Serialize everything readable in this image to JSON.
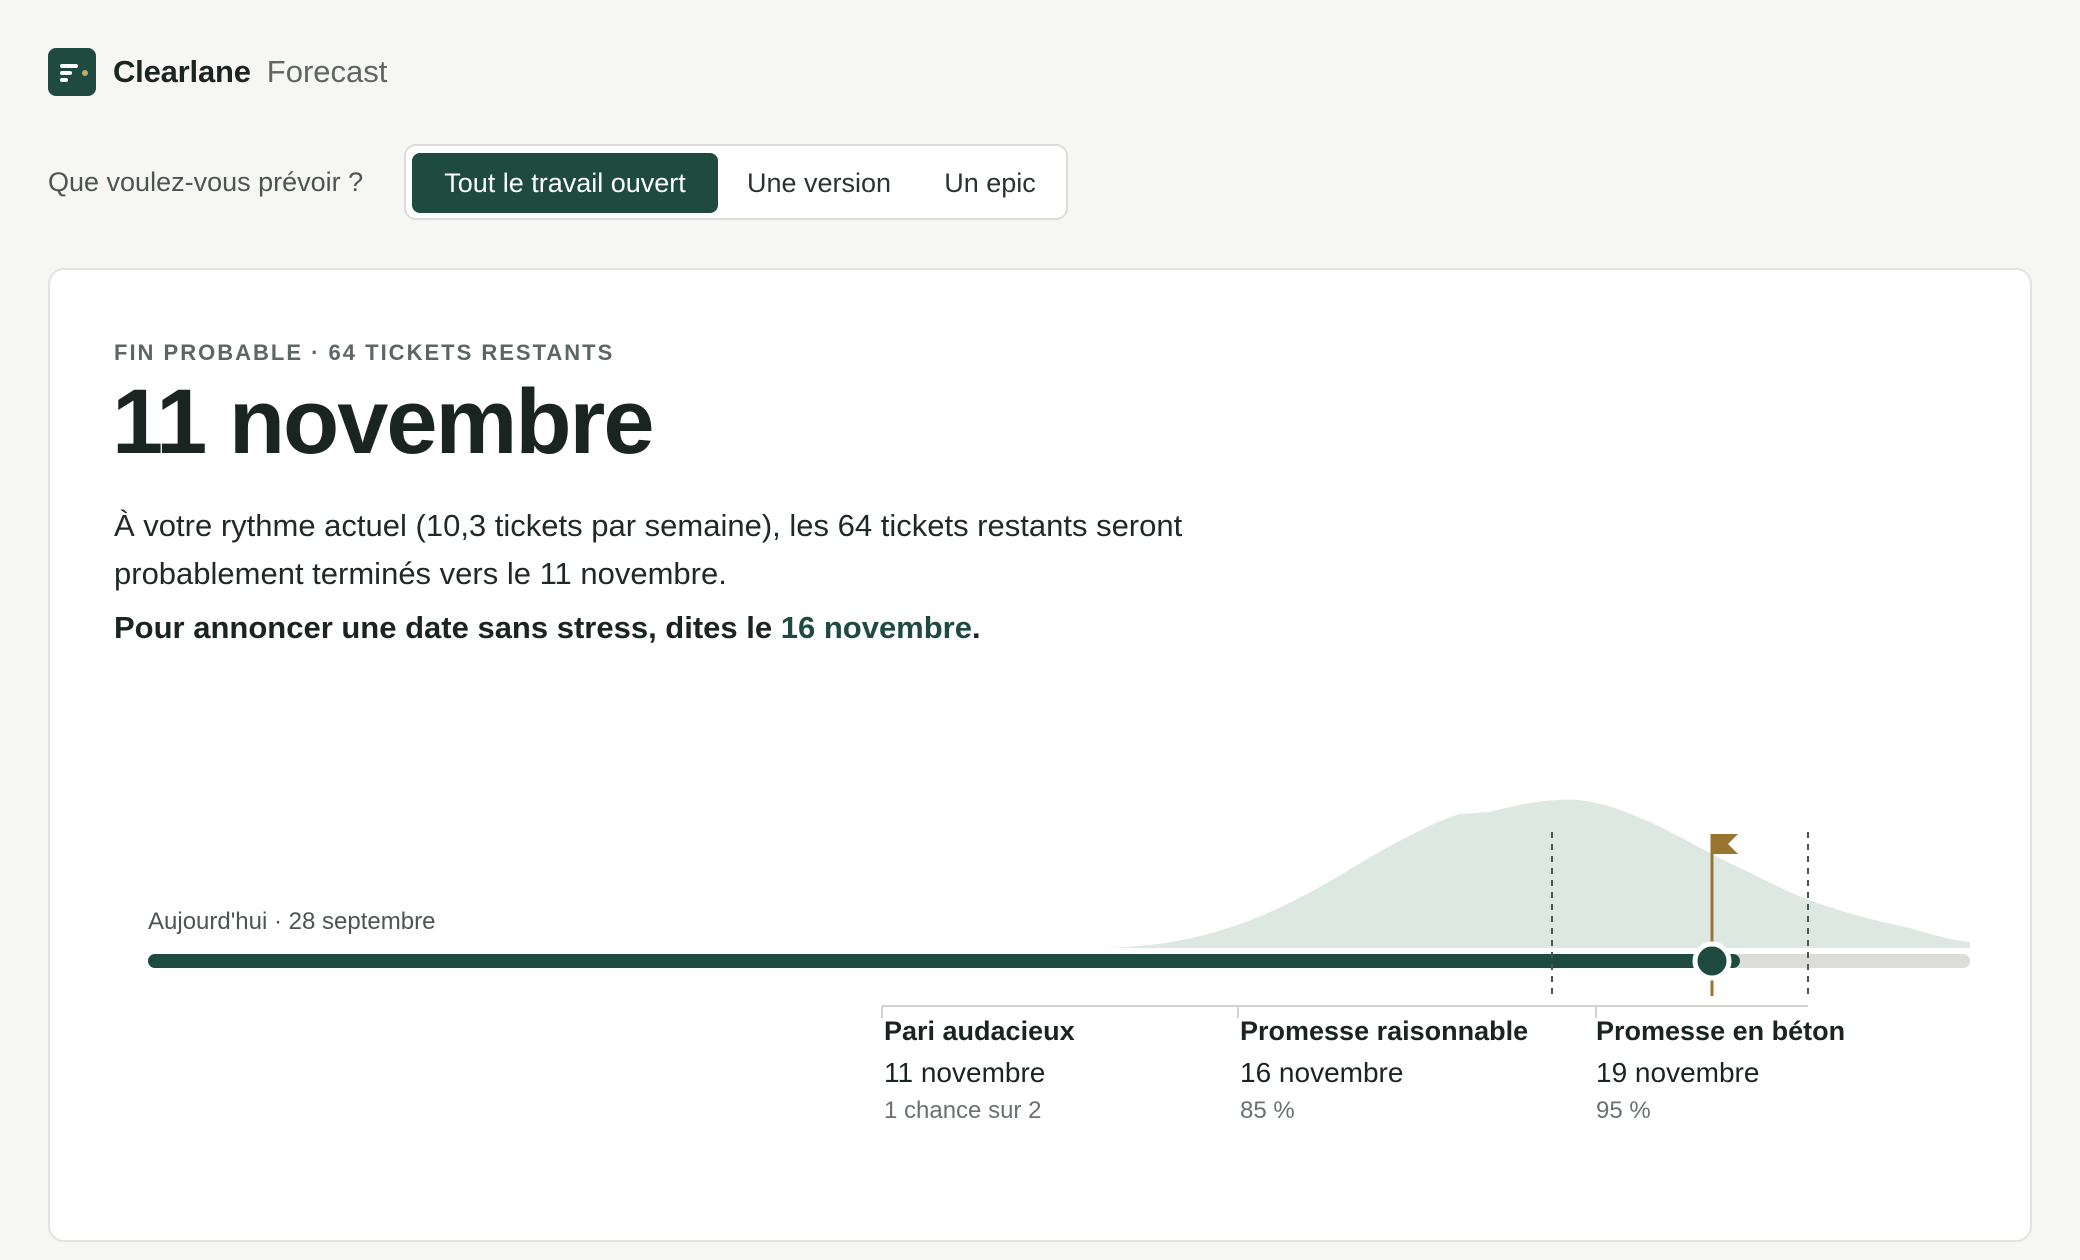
{
  "brand": {
    "name": "Clearlane",
    "product": "Forecast",
    "logo_icon": "forecast-logo-icon"
  },
  "scope": {
    "question": "Que voulez-vous prévoir ?",
    "options": [
      {
        "label": "Tout le travail ouvert",
        "selected": true
      },
      {
        "label": "Une version",
        "selected": false
      },
      {
        "label": "Un epic",
        "selected": false
      }
    ]
  },
  "forecast": {
    "eyebrow": "FIN PROBABLE · 64 TICKETS RESTANTS",
    "headline_date": "11 novembre",
    "summary": "À votre rythme actuel (10,3 tickets par semaine), les 64 tickets restants seront probablement terminés vers le 11 novembre.",
    "advice_prefix": "Pour annoncer une date sans stress, dites le ",
    "advice_date": "16 novembre",
    "advice_suffix": "."
  },
  "timeline": {
    "today_label": "Aujourd'hui · 28 septembre",
    "progress_fraction": 0.874,
    "colors": {
      "accent": "#1f4a40",
      "distribution": "#dde8e3",
      "flag": "#9a7530",
      "track": "#dcdcd8"
    },
    "tiers": [
      {
        "title": "Pari audacieux",
        "date": "11 novembre",
        "probability": "1 chance sur 2"
      },
      {
        "title": "Promesse raisonnable",
        "date": "16 novembre",
        "probability": "85 %"
      },
      {
        "title": "Promesse en béton",
        "date": "19 novembre",
        "probability": "95 %"
      }
    ]
  }
}
